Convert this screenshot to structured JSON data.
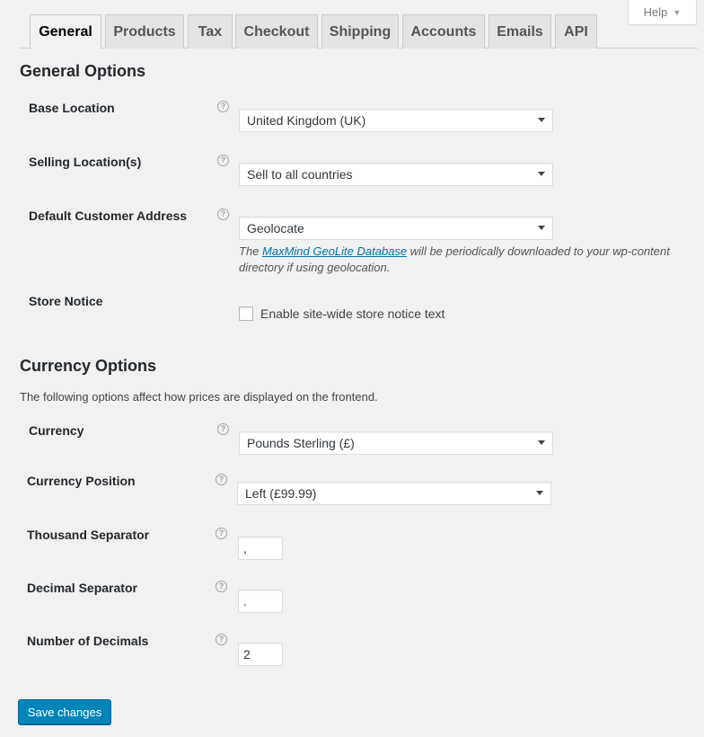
{
  "help": {
    "label": "Help"
  },
  "tabs": [
    {
      "label": "General"
    },
    {
      "label": "Products"
    },
    {
      "label": "Tax"
    },
    {
      "label": "Checkout"
    },
    {
      "label": "Shipping"
    },
    {
      "label": "Accounts"
    },
    {
      "label": "Emails"
    },
    {
      "label": "API"
    }
  ],
  "general": {
    "title": "General Options",
    "base_location": {
      "label": "Base Location",
      "value": "United Kingdom (UK)"
    },
    "selling_locations": {
      "label": "Selling Location(s)",
      "value": "Sell to all countries"
    },
    "default_address": {
      "label": "Default Customer Address",
      "value": "Geolocate",
      "desc_prefix": "The ",
      "desc_link": "MaxMind GeoLite Database",
      "desc_suffix_line1": " will be periodically downloaded to your wp-content",
      "desc_line2": "directory if using geolocation."
    },
    "store_notice": {
      "label": "Store Notice",
      "checkbox_label": "Enable site-wide store notice text",
      "checked": false
    }
  },
  "currency": {
    "title": "Currency Options",
    "description": "The following options affect how prices are displayed on the frontend.",
    "currency": {
      "label": "Currency",
      "value": "Pounds Sterling (£)"
    },
    "position": {
      "label": "Currency Position",
      "value": "Left (£99.99)"
    },
    "thousand_sep": {
      "label": "Thousand Separator",
      "value": ","
    },
    "decimal_sep": {
      "label": "Decimal Separator",
      "value": "."
    },
    "num_decimals": {
      "label": "Number of Decimals",
      "value": "2"
    }
  },
  "save": {
    "label": "Save changes"
  },
  "icons": {
    "help": "question-mark-circle-icon",
    "caret": "caret-down-icon"
  },
  "colors": {
    "primary_button": "#0085ba",
    "link": "#0073aa",
    "background": "#f1f1f1"
  }
}
